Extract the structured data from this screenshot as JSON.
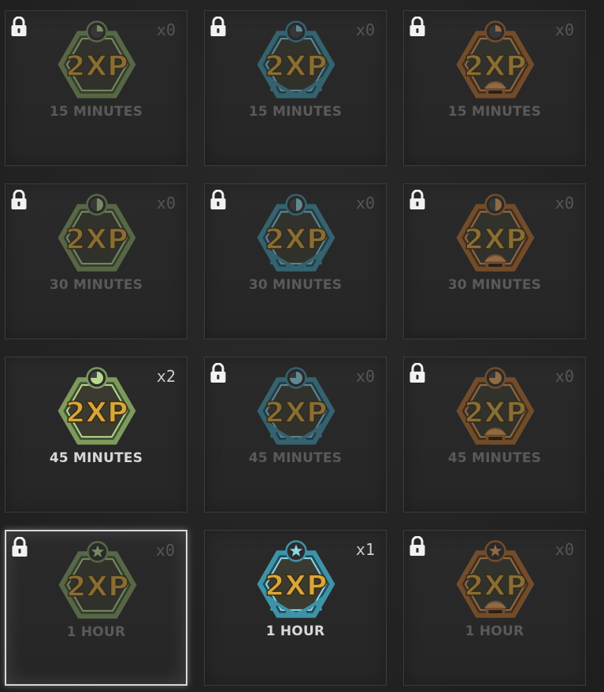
{
  "tiles": [
    {
      "duration_label": "15 MINUTES",
      "count": "x0",
      "locked": true,
      "variant": "green",
      "top_icon": "clock-quarter",
      "selected": false
    },
    {
      "duration_label": "15 MINUTES",
      "count": "x0",
      "locked": true,
      "variant": "blue",
      "top_icon": "clock-quarter",
      "selected": false
    },
    {
      "duration_label": "15 MINUTES",
      "count": "x0",
      "locked": true,
      "variant": "orange",
      "top_icon": "clock-quarter",
      "selected": false
    },
    {
      "duration_label": "30 MINUTES",
      "count": "x0",
      "locked": true,
      "variant": "green",
      "top_icon": "clock-half",
      "selected": false
    },
    {
      "duration_label": "30 MINUTES",
      "count": "x0",
      "locked": true,
      "variant": "blue",
      "top_icon": "clock-half",
      "selected": false
    },
    {
      "duration_label": "30 MINUTES",
      "count": "x0",
      "locked": true,
      "variant": "orange",
      "top_icon": "clock-half",
      "selected": false
    },
    {
      "duration_label": "45 MINUTES",
      "count": "x2",
      "locked": false,
      "variant": "green",
      "top_icon": "clock-three-quarter",
      "selected": false
    },
    {
      "duration_label": "45 MINUTES",
      "count": "x0",
      "locked": true,
      "variant": "blue",
      "top_icon": "clock-three-quarter",
      "selected": false
    },
    {
      "duration_label": "45 MINUTES",
      "count": "x0",
      "locked": true,
      "variant": "orange",
      "top_icon": "clock-three-quarter",
      "selected": false
    },
    {
      "duration_label": "1 HOUR",
      "count": "x0",
      "locked": true,
      "variant": "green",
      "top_icon": "star",
      "selected": true
    },
    {
      "duration_label": "1 HOUR",
      "count": "x1",
      "locked": false,
      "variant": "blue",
      "top_icon": "star",
      "selected": false
    },
    {
      "duration_label": "1 HOUR",
      "count": "x0",
      "locked": true,
      "variant": "orange",
      "top_icon": "star",
      "selected": false
    }
  ],
  "badge_text": "2XP",
  "colors": {
    "green": {
      "frame": "#7f9a5d",
      "light": "#b9d88f",
      "dark": "#3f5232",
      "accent": "#6aa84f"
    },
    "blue": {
      "frame": "#3f93a8",
      "light": "#8fd6e8",
      "dark": "#1f4f5c",
      "accent": "#4fc0dc"
    },
    "orange": {
      "frame": "#b06a2a",
      "light": "#e3a15e",
      "dark": "#5c3416",
      "accent": "#d07a33"
    },
    "text_fill": "#d9a63a"
  },
  "icons": {
    "lock": "padlock-icon",
    "badge": "xp-token-badge"
  }
}
